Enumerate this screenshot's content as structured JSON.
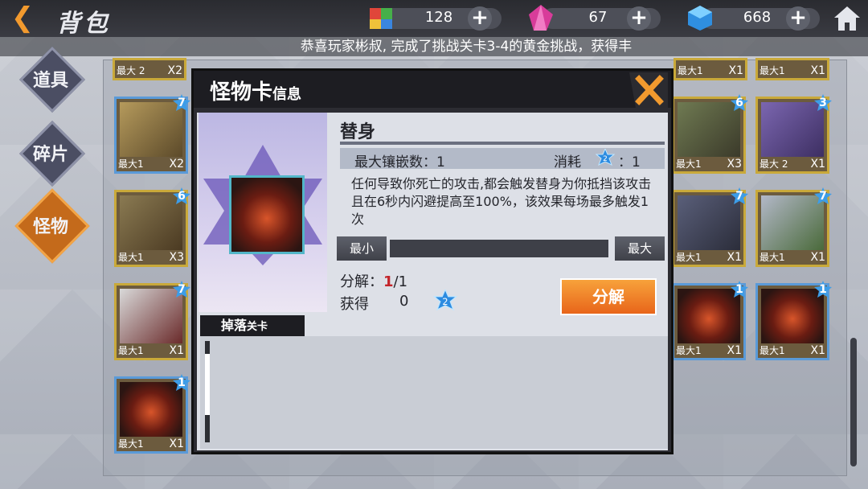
{
  "header": {
    "title": "背包",
    "resources": [
      {
        "icon": "puzzle-icon",
        "value": "128"
      },
      {
        "icon": "pink-crystal-icon",
        "value": "67"
      },
      {
        "icon": "blue-cube-icon",
        "value": "668"
      }
    ]
  },
  "marquee": "恭喜玩家彬叔, 完成了挑战关卡3-4的黄金挑战，获得丰",
  "tabs": [
    "道具",
    "碎片",
    "怪物"
  ],
  "cards": [
    {
      "max": "最大 2",
      "count": "X2"
    },
    {
      "max": "最大1",
      "count": "X1"
    },
    {
      "max": "最大1",
      "count": "X1"
    },
    {
      "star": "7",
      "max": "最大1",
      "count": "X2"
    },
    {
      "star": "6",
      "max": "最大1",
      "count": "X3"
    },
    {
      "star": "3",
      "max": "最大 2",
      "count": "X1"
    },
    {
      "star": "6",
      "max": "最大1",
      "count": "X3"
    },
    {
      "star": "7",
      "max": "最大1",
      "count": "X1"
    },
    {
      "star": "7",
      "max": "最大1",
      "count": "X1"
    },
    {
      "star": "7",
      "max": "最大1",
      "count": "X1"
    },
    {
      "star": "1",
      "max": "最大1",
      "count": "X1"
    },
    {
      "star": "1",
      "max": "最大1",
      "count": "X1"
    },
    {
      "star": "1",
      "max": "最大1",
      "count": "X1"
    }
  ],
  "modal": {
    "title": "怪物卡",
    "title_small": "信息",
    "card_name": "替身",
    "max_inlay_label": "最大镶嵌数：1",
    "cost_label": "消耗",
    "cost_value": "：1",
    "gem_number": "2",
    "description": "任何导致你死亡的攻击,都会触发替身为你抵挡该攻击且在6秒内闪避提高至100%，该效果每场最多触发1次",
    "min_label": "最小",
    "max_label": "最大",
    "decompose_label": "分解：",
    "decompose_current": "1",
    "decompose_total": "/1",
    "obtain_label": "获得",
    "obtain_value": "0",
    "decompose_button": "分解",
    "drop_label": "掉落",
    "drop_label_small": "关卡"
  }
}
